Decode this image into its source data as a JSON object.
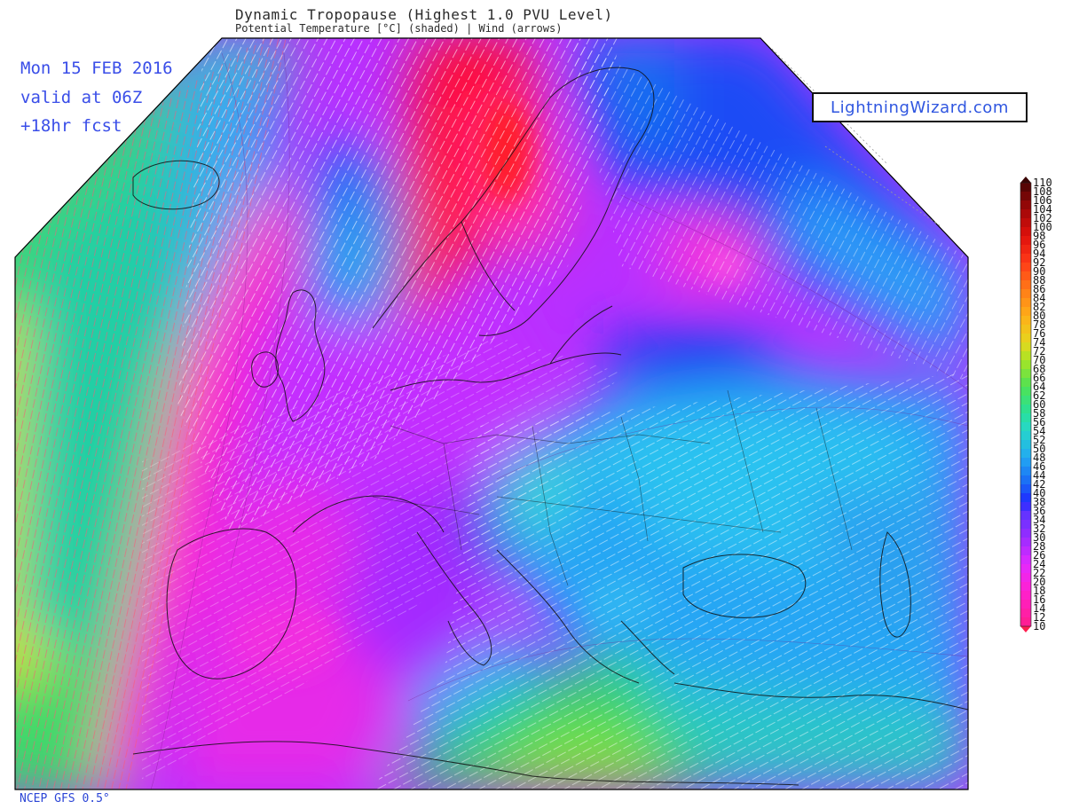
{
  "header": {
    "title": "Dynamic Tropopause (Highest 1.0 PVU Level)",
    "subtitle": "Potential Temperature [°C] (shaded) | Wind (arrows)"
  },
  "forecast": {
    "date": "Mon 15 FEB 2016",
    "valid": "valid at 06Z",
    "lead": "+18hr fcst"
  },
  "brand": {
    "label": "LightningWizard.com"
  },
  "footer": {
    "model": "NCEP GFS 0.5°"
  },
  "colorbar": {
    "min": 10,
    "max": 110,
    "step": 2,
    "labels": [
      "110",
      "108",
      "106",
      "104",
      "102",
      "100",
      "98",
      "96",
      "94",
      "92",
      "90",
      "88",
      "86",
      "84",
      "82",
      "80",
      "78",
      "76",
      "74",
      "72",
      "70",
      "68",
      "66",
      "64",
      "62",
      "60",
      "58",
      "56",
      "54",
      "52",
      "50",
      "48",
      "46",
      "44",
      "42",
      "40",
      "38",
      "36",
      "34",
      "32",
      "30",
      "28",
      "26",
      "24",
      "22",
      "20",
      "18",
      "16",
      "14",
      "12",
      "10"
    ]
  },
  "colors": {
    "info_text": "#3a4ee8",
    "brand_text": "#2f56e0",
    "land_outline": "#111111"
  }
}
